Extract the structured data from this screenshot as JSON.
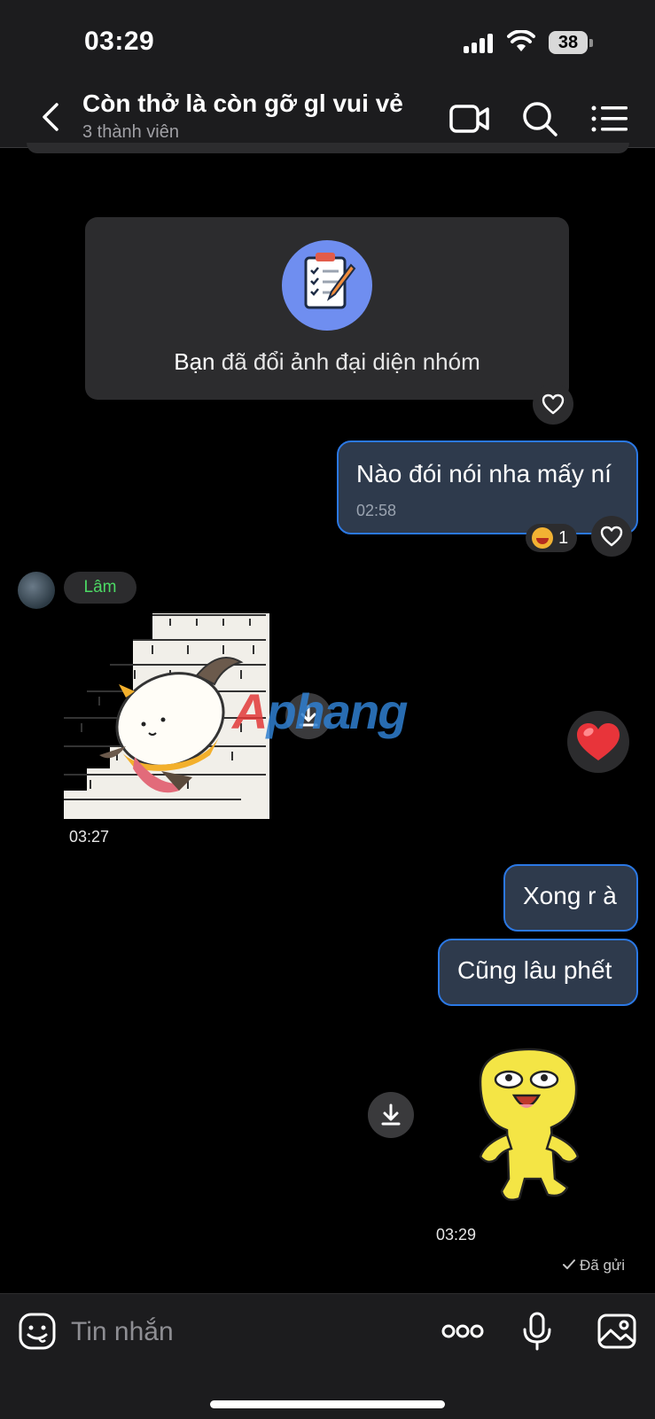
{
  "status_bar": {
    "time": "03:29",
    "battery": "38"
  },
  "header": {
    "title": "Còn thở là còn gỡ gl vui vẻ",
    "subtitle": "3 thành viên"
  },
  "system_message": {
    "actor": "Bạn",
    "text": " đã đổi ảnh đại diện nhóm"
  },
  "messages": [
    {
      "text": "Nào đói nói nha mấy ní",
      "time": "02:58",
      "reaction_count": "1"
    },
    {
      "sender": "Lâm",
      "type": "sticker",
      "time": "03:27"
    },
    {
      "text": "Xong r à"
    },
    {
      "text": "Cũng lâu phết"
    },
    {
      "type": "sticker",
      "time": "03:29"
    }
  ],
  "watermark": {
    "first": "A",
    "rest": "phang"
  },
  "sent_status": "Đã gửi",
  "composer": {
    "placeholder": "Tin nhắn"
  },
  "colors": {
    "accent": "#2b78e4",
    "bubble": "#2e3a4c",
    "sender": "#4cd964",
    "heart": "#e8343a"
  }
}
